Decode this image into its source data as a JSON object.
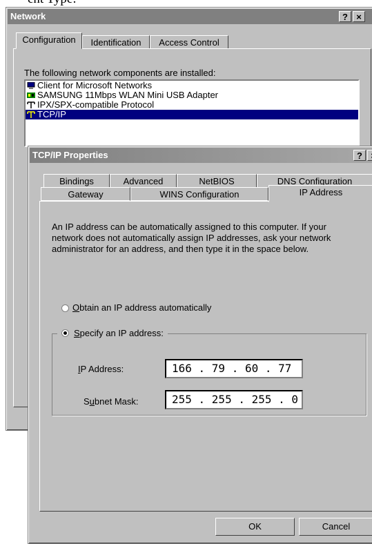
{
  "caption": "ent Type:",
  "network_window": {
    "title": "Network",
    "help_button": "?",
    "close_button": "×",
    "tabs": [
      "Configuration",
      "Identification",
      "Access Control"
    ],
    "components_label": "The following network components are installed:",
    "components": [
      {
        "label": "Client for Microsoft Networks",
        "icon": "client-icon"
      },
      {
        "label": "SAMSUNG 11Mbps WLAN Mini USB Adapter",
        "icon": "adapter-icon"
      },
      {
        "label": "IPX/SPX-compatible Protocol",
        "icon": "protocol-icon"
      },
      {
        "label": "TCP/IP",
        "icon": "protocol-icon",
        "selected": true
      }
    ]
  },
  "tcpip_window": {
    "title": "TCP/IP Properties",
    "help_button": "?",
    "close_button": "×",
    "tabs_row1": [
      "Bindings",
      "Advanced",
      "NetBIOS",
      "DNS Configuration"
    ],
    "tabs_row2": [
      "Gateway",
      "WINS Configuration",
      "IP Address"
    ],
    "selected_tab": "IP Address",
    "description": "An IP address can be automatically assigned to this computer.  If your network does not automatically assign IP addresses, ask your network administrator for an address, and then type it in the space below.",
    "option_auto": "Obtain an IP address automatically",
    "option_specify": "Specify an IP address:",
    "selected_option": "specify",
    "ip_label": "IP Address:",
    "ip_value": "166 . 79 . 60 . 77",
    "subnet_label": "Subnet Mask:",
    "subnet_value": "255 . 255 . 255 .  0",
    "ok_button": "OK",
    "cancel_button": "Cancel"
  },
  "colors": {
    "selection": "#000080",
    "face": "#c0c0c0",
    "title_inactive": "#808080"
  }
}
